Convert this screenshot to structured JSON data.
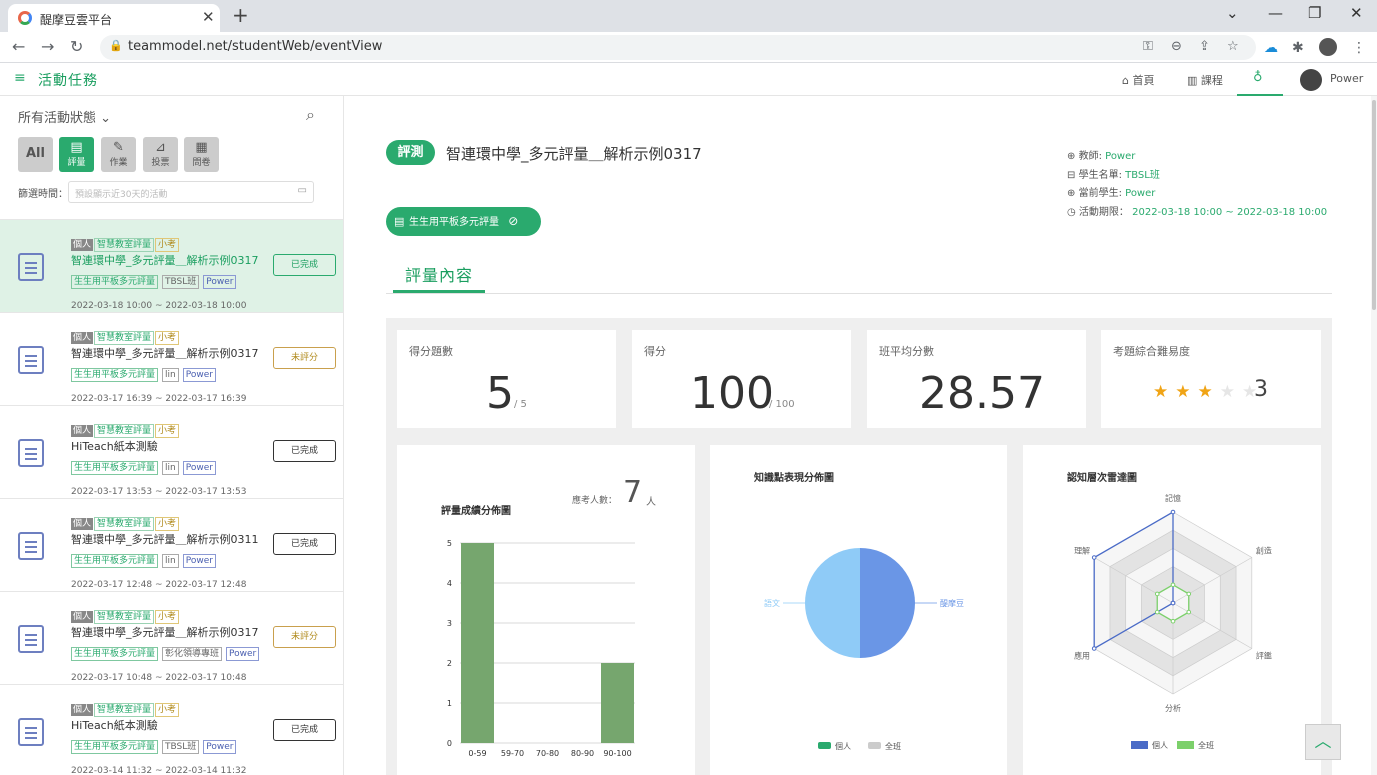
{
  "browser": {
    "tab_title": "醍摩豆雲平台",
    "url": "teammodel.net/studentWeb/eventView"
  },
  "app": {
    "title": "活動任務",
    "nav": [
      {
        "label": "首頁"
      },
      {
        "label": "課程"
      },
      {
        "label": "Power"
      }
    ]
  },
  "sidebar": {
    "filter_label": "所有活動狀態",
    "type_buttons": {
      "all": "All",
      "eval": "評量",
      "homework": "作業",
      "vote": "投票",
      "survey": "問卷"
    },
    "date_label": "篩選時間：",
    "date_placeholder": "預設顯示近30天的活動",
    "items": [
      {
        "tags": [
          "個人",
          "智慧教室評量",
          "小考"
        ],
        "title": "智連環中學_多元評量＿解析示例0317",
        "tags2": [
          "生生用平板多元評量",
          "TBSL班",
          "Power"
        ],
        "date": "2022-03-18 10:00 ~ 2022-03-18 10:00",
        "status": "已完成"
      },
      {
        "tags": [
          "個人",
          "智慧教室評量",
          "小考"
        ],
        "title": "智連環中學_多元評量＿解析示例0317",
        "tags2": [
          "生生用平板多元評量",
          "lin",
          "Power"
        ],
        "date": "2022-03-17 16:39 ~ 2022-03-17 16:39",
        "status": "未評分"
      },
      {
        "tags": [
          "個人",
          "智慧教室評量",
          "小考"
        ],
        "title": "HiTeach紙本測驗",
        "tags2": [
          "生生用平板多元評量",
          "lin",
          "Power"
        ],
        "date": "2022-03-17 13:53 ~ 2022-03-17 13:53",
        "status": "已完成"
      },
      {
        "tags": [
          "個人",
          "智慧教室評量",
          "小考"
        ],
        "title": "智連環中學_多元評量＿解析示例0311",
        "tags2": [
          "生生用平板多元評量",
          "lin",
          "Power"
        ],
        "date": "2022-03-17 12:48 ~ 2022-03-17 12:48",
        "status": "已完成"
      },
      {
        "tags": [
          "個人",
          "智慧教室評量",
          "小考"
        ],
        "title": "智連環中學_多元評量＿解析示例0317",
        "tags2": [
          "生生用平板多元評量",
          "彰化領導專班",
          "Power"
        ],
        "date": "2022-03-17 10:48 ~ 2022-03-17 10:48",
        "status": "未評分"
      },
      {
        "tags": [
          "個人",
          "智慧教室評量",
          "小考"
        ],
        "title": "HiTeach紙本測驗",
        "tags2": [
          "生生用平板多元評量",
          "TBSL班",
          "Power"
        ],
        "date": "2022-03-14 11:32 ~ 2022-03-14 11:32",
        "status": "已完成"
      }
    ]
  },
  "main": {
    "badge": "評測",
    "title": "智連環中學_多元評量＿解析示例0317",
    "info": {
      "teacher_label": "教師:",
      "teacher": "Power",
      "roster_label": "學生名單:",
      "roster": "TBSL班",
      "student_label": "當前學生:",
      "student": "Power",
      "period_label": "活動期限：",
      "period": "2022-03-18 10:00 ~ 2022-03-18 10:00"
    },
    "scope": "生生用平板多元評量",
    "section": "評量內容",
    "stats": [
      {
        "label": "得分題數",
        "value": "5",
        "sub": "/ 5"
      },
      {
        "label": "得分",
        "value": "100",
        "sub": "/ 100"
      },
      {
        "label": "班平均分數",
        "value": "28.57"
      },
      {
        "label": "考題綜合難易度",
        "value": "3",
        "rating": 3,
        "max": 5
      }
    ],
    "charts": {
      "respondents_label": "應考人數：",
      "respondents": "7",
      "respondents_unit": "人"
    }
  },
  "chart_data": [
    {
      "type": "bar",
      "title": "評量成績分佈圖",
      "categories": [
        "0-59",
        "59-70",
        "70-80",
        "80-90",
        "90-100"
      ],
      "values": [
        5,
        0,
        0,
        0,
        2
      ],
      "ylim": [
        0,
        5
      ],
      "yticks": [
        "0",
        "1",
        "2",
        "3",
        "4",
        "5"
      ],
      "color": "#76a66e"
    },
    {
      "type": "pie",
      "title": "知識點表現分佈圖",
      "labels": [
        "醍摩豆",
        "語文"
      ],
      "values": [
        50,
        50
      ],
      "colors": [
        "#6a96e6",
        "#8fcbf7"
      ],
      "legend": [
        "個人",
        "全班"
      ],
      "legend_colors": [
        "#2aaa6e",
        "#cccccc"
      ]
    },
    {
      "type": "radar",
      "title": "認知層次雷達圖",
      "axes": [
        "記憶",
        "創造",
        "評鑑",
        "分析",
        "應用",
        "理解"
      ],
      "series": [
        {
          "name": "個人",
          "values": [
            5,
            0,
            0,
            0,
            5,
            5
          ],
          "color": "#4a6bc7"
        },
        {
          "name": "全班",
          "values": [
            1,
            1,
            1,
            1,
            1,
            1
          ],
          "color": "#7cd06b"
        }
      ],
      "rmax": 5
    }
  ]
}
